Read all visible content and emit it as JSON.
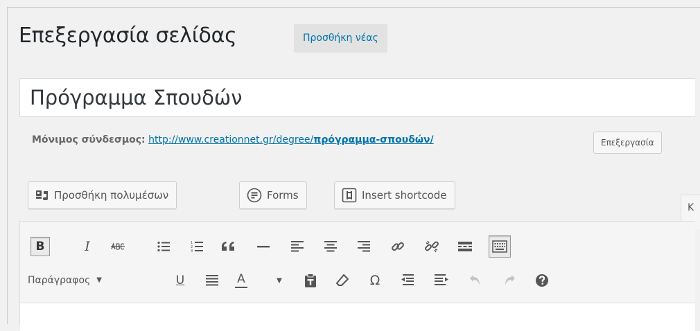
{
  "header": {
    "page_title": "Επεξεργασία σελίδας",
    "add_new_label": "Προσθήκη νέας"
  },
  "title_field": {
    "value": "Πρόγραμμα Σπουδών"
  },
  "permalink": {
    "label": "Μόνιμος σύνδεσμος:",
    "url_base": "http://www.creationnet.gr/degree/",
    "url_slug": "πρόγραμμα-σπουδών/",
    "edit_label": "Επεξεργασία"
  },
  "media_buttons": {
    "add_media": "Προσθήκη πολυμέσων",
    "forms": "Forms",
    "insert_shortcode": "Insert shortcode"
  },
  "editor_tab_partial": "Κ",
  "toolbar": {
    "row1": [
      "bold-icon",
      "italic-icon",
      "strikethrough-icon",
      "bullet-list-icon",
      "numbered-list-icon",
      "blockquote-icon",
      "horizontal-line-icon",
      "align-left-icon",
      "align-center-icon",
      "align-right-icon",
      "link-icon",
      "unlink-icon",
      "read-more-icon",
      "toolbar-toggle-icon"
    ],
    "row2": [
      "underline-icon",
      "justify-icon",
      "text-color-icon",
      "paste-text-icon",
      "clear-formatting-icon",
      "special-character-icon",
      "outdent-icon",
      "indent-icon",
      "undo-icon",
      "redo-icon",
      "help-icon"
    ],
    "bold_glyph": "B",
    "italic_glyph": "I",
    "underline_glyph": "U",
    "text_color_glyph": "A",
    "omega_glyph": "Ω",
    "format_select_value": "Παράγραφος"
  },
  "colors": {
    "link": "#0073aa",
    "icon": "#555555",
    "background": "#f1f1f1"
  }
}
